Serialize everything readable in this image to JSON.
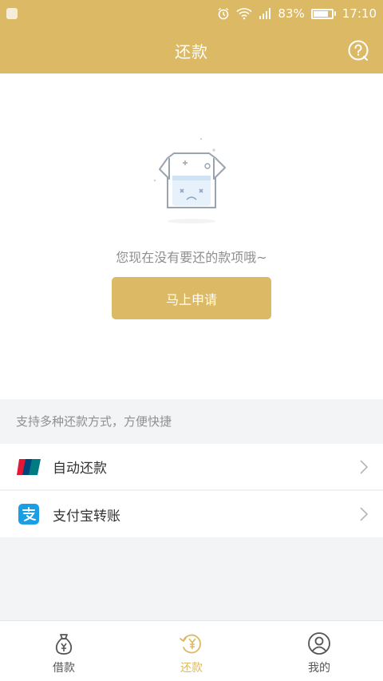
{
  "status_bar": {
    "time": "17:10",
    "battery_percent": "83%",
    "battery_level": 0.83,
    "icons": [
      "app-notification-icon",
      "alarm-icon",
      "wifi-icon",
      "signal-icon",
      "battery-icon"
    ]
  },
  "header": {
    "title": "还款",
    "help_icon": "question-icon"
  },
  "empty_state": {
    "message": "您现在没有要还的款项哦~",
    "button_label": "马上申请"
  },
  "payment_methods": {
    "header": "支持多种还款方式，方便快捷",
    "items": [
      {
        "label": "自动还款",
        "icon": "unionpay-icon"
      },
      {
        "label": "支付宝转账",
        "icon": "alipay-icon"
      }
    ]
  },
  "tabs": [
    {
      "label": "借款",
      "icon": "money-bag-icon",
      "active": false
    },
    {
      "label": "还款",
      "icon": "repay-icon",
      "active": true
    },
    {
      "label": "我的",
      "icon": "user-icon",
      "active": false
    }
  ],
  "colors": {
    "accent": "#dbb965",
    "page_background": "#f3f4f6",
    "muted_text": "#8f8f8f",
    "alipay_blue": "#1a9ee6"
  }
}
